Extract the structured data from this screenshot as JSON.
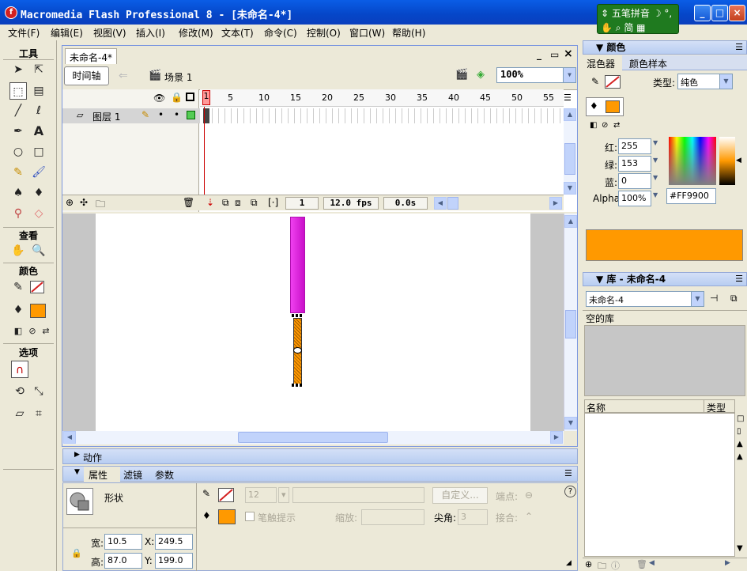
{
  "window": {
    "title": "Macromedia Flash Professional 8 - [未命名-4*]",
    "min": "_",
    "max": "□",
    "close": "×"
  },
  "ime": {
    "row1": "五笔拼音",
    "row2": "简",
    "moon": "☽",
    "punct": "°,",
    "toggle": "⇕",
    "hand": "✋",
    "grid": "▦"
  },
  "menu": [
    "文件(F)",
    "编辑(E)",
    "视图(V)",
    "插入(I)",
    "修改(M)",
    "文本(T)",
    "命令(C)",
    "控制(O)",
    "窗口(W)",
    "帮助(H)"
  ],
  "toolbox": {
    "title": "工具",
    "view_label": "查看",
    "colors_label": "颜色",
    "options_label": "选项",
    "colors": {
      "stroke": "#d42020",
      "fill": "#ff9900"
    }
  },
  "document": {
    "tab": "未命名-4*",
    "timeline_button": "时间轴",
    "scene": "场景 1",
    "zoom": "100%",
    "doc_min": "_",
    "doc_restore": "▭",
    "doc_close": "×"
  },
  "timeline": {
    "ruler": [
      "1",
      "5",
      "10",
      "15",
      "20",
      "25",
      "30",
      "35",
      "40",
      "45",
      "50",
      "55"
    ],
    "layer_name": "图层 1",
    "current_frame": "1",
    "fps": "12.0 fps",
    "time": "0.0s"
  },
  "stage": {
    "bar_color": "#e020e0",
    "selected_color": "#ff9900"
  },
  "actions_panel": {
    "title": "动作"
  },
  "properties": {
    "tabs": [
      "属性",
      "滤镜",
      "参数"
    ],
    "shape_label": "形状",
    "stroke_size": "12",
    "custom_button": "自定义...",
    "endpoint_label": "端点:",
    "hinting_label": "笔触提示",
    "scale_label": "缩放:",
    "miter_label": "尖角:",
    "miter_value": "3",
    "join_label": "接合:",
    "width_label": "宽:",
    "width": "10.5",
    "height_label": "高:",
    "height": "87.0",
    "x_label": "X:",
    "x": "249.5",
    "y_label": "Y:",
    "y": "199.0",
    "help": "?"
  },
  "color_panel": {
    "title": "颜色",
    "tabs": [
      "混色器",
      "颜色样本"
    ],
    "type_label": "类型:",
    "type_value": "纯色",
    "red_label": "红:",
    "red": "255",
    "green_label": "绿:",
    "green": "153",
    "blue_label": "蓝:",
    "blue": "0",
    "alpha_label": "Alpha:",
    "alpha": "100%",
    "hex": "#FF9900",
    "preview_color": "#ff9900"
  },
  "library_panel": {
    "title": "库 - 未命名-4",
    "doc_select": "未命名-4",
    "empty_label": "空的库",
    "col_name": "名称",
    "col_type": "类型"
  }
}
